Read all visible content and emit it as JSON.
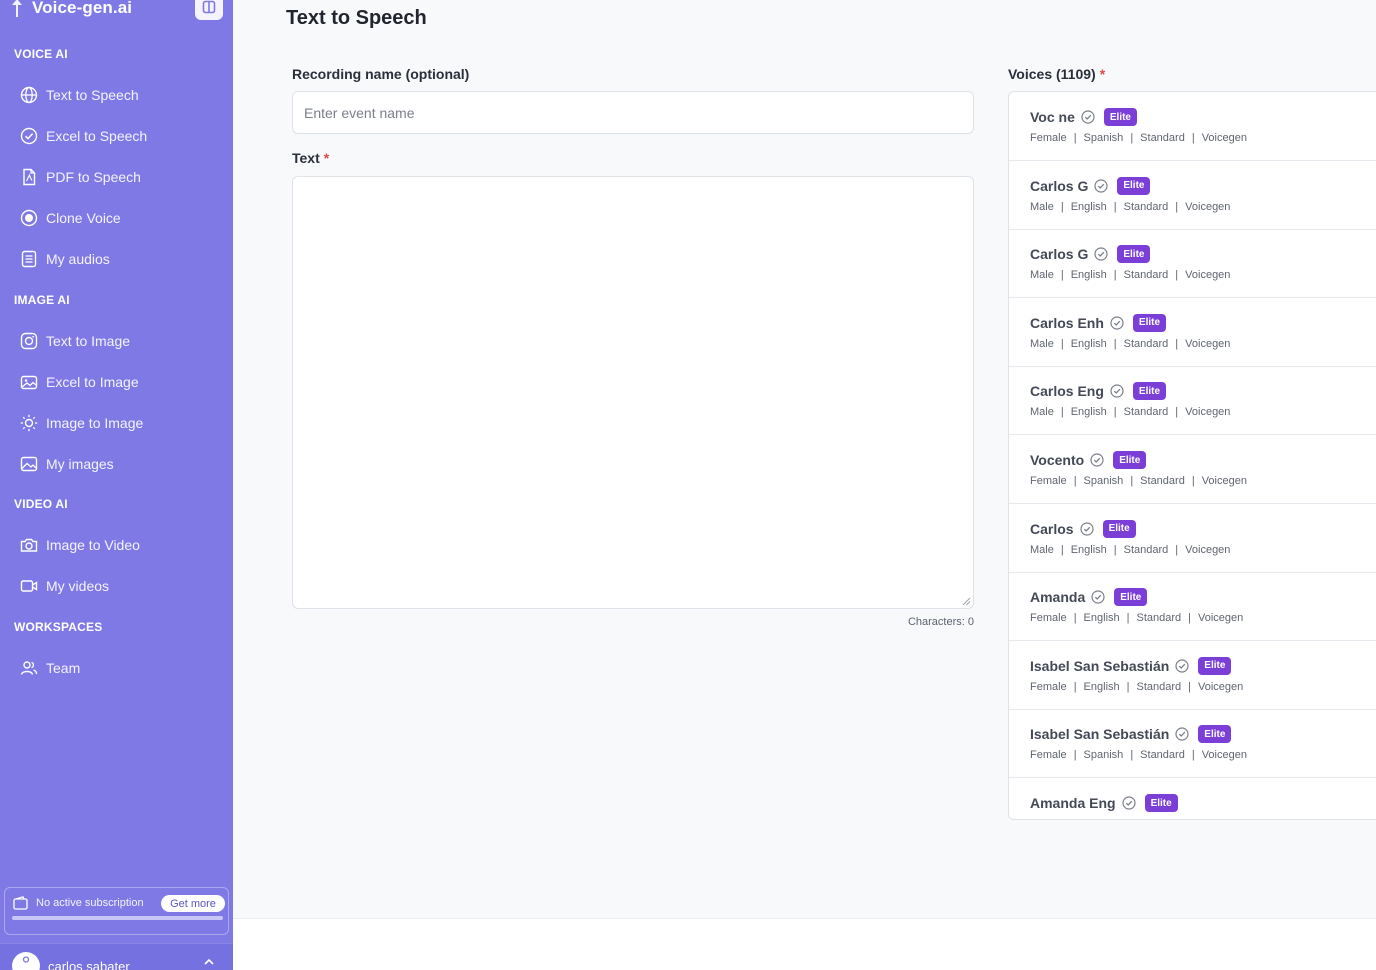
{
  "app": {
    "name": "Voice-gen.ai"
  },
  "sidebar": {
    "sections": [
      {
        "title": "VOICE AI",
        "items": [
          {
            "label": "Text to Speech",
            "icon": "globe-icon"
          },
          {
            "label": "Excel to Speech",
            "icon": "check-circle-icon"
          },
          {
            "label": "PDF to Speech",
            "icon": "pdf-file-icon"
          },
          {
            "label": "Clone Voice",
            "icon": "record-icon"
          },
          {
            "label": "My audios",
            "icon": "list-document-icon"
          }
        ]
      },
      {
        "title": "IMAGE AI",
        "items": [
          {
            "label": "Text to Image",
            "icon": "instagram-icon"
          },
          {
            "label": "Excel to Image",
            "icon": "image-stack-icon"
          },
          {
            "label": "Image to Image",
            "icon": "sun-icon"
          },
          {
            "label": "My images",
            "icon": "image-icon"
          }
        ]
      },
      {
        "title": "VIDEO AI",
        "items": [
          {
            "label": "Image to Video",
            "icon": "camera-icon"
          },
          {
            "label": "My videos",
            "icon": "video-icon"
          }
        ]
      },
      {
        "title": "WORKSPACES",
        "items": [
          {
            "label": "Team",
            "icon": "team-icon"
          }
        ]
      }
    ],
    "subscription": {
      "text": "No active subscription",
      "button": "Get more"
    },
    "user": {
      "name": "carlos sabater"
    }
  },
  "main": {
    "title": "Text to Speech",
    "recording_name": {
      "label": "Recording name (optional)",
      "placeholder": "Enter event name",
      "value": ""
    },
    "text": {
      "label": "Text",
      "required_mark": "*",
      "value": ""
    },
    "characters": "Characters: 0"
  },
  "voices": {
    "label": "Voices (1109)",
    "required_mark": "*",
    "items": [
      {
        "name": "Voc ne",
        "badge": "Elite",
        "gender": "Female",
        "language": "Spanish",
        "tier": "Standard",
        "provider": "Voicegen"
      },
      {
        "name": "Carlos G",
        "badge": "Elite",
        "gender": "Male",
        "language": "English",
        "tier": "Standard",
        "provider": "Voicegen"
      },
      {
        "name": "Carlos G",
        "badge": "Elite",
        "gender": "Male",
        "language": "English",
        "tier": "Standard",
        "provider": "Voicegen"
      },
      {
        "name": "Carlos Enh",
        "badge": "Elite",
        "gender": "Male",
        "language": "English",
        "tier": "Standard",
        "provider": "Voicegen"
      },
      {
        "name": "Carlos Eng",
        "badge": "Elite",
        "gender": "Male",
        "language": "English",
        "tier": "Standard",
        "provider": "Voicegen"
      },
      {
        "name": "Vocento",
        "badge": "Elite",
        "gender": "Female",
        "language": "Spanish",
        "tier": "Standard",
        "provider": "Voicegen"
      },
      {
        "name": "Carlos",
        "badge": "Elite",
        "gender": "Male",
        "language": "English",
        "tier": "Standard",
        "provider": "Voicegen"
      },
      {
        "name": "Amanda",
        "badge": "Elite",
        "gender": "Female",
        "language": "English",
        "tier": "Standard",
        "provider": "Voicegen"
      },
      {
        "name": "Isabel San Sebastián",
        "badge": "Elite",
        "gender": "Female",
        "language": "English",
        "tier": "Standard",
        "provider": "Voicegen"
      },
      {
        "name": "Isabel San Sebastián",
        "badge": "Elite",
        "gender": "Female",
        "language": "Spanish",
        "tier": "Standard",
        "provider": "Voicegen"
      },
      {
        "name": "Amanda Eng",
        "badge": "Elite",
        "gender": "",
        "language": "",
        "tier": "",
        "provider": ""
      }
    ]
  }
}
